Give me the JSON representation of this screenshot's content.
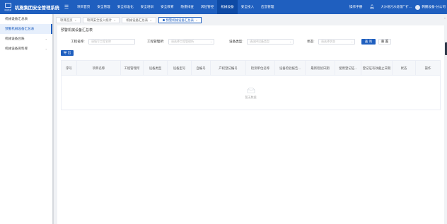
{
  "app": {
    "logo_text": "中国铁建",
    "title": "机施集团安全管理系统"
  },
  "nav": [
    "项目首页",
    "安全管理",
    "安全标准化",
    "安全培训",
    "安全教育",
    "隐患排查",
    "风险管控",
    "机械设备",
    "安全投入",
    "应急管理"
  ],
  "nav_active": 7,
  "header": {
    "manual": "操作手册",
    "org": "大沙地污水处理厂扩…",
    "user": "韩鹏设备-分公司"
  },
  "sidebar": [
    {
      "label": "机械设备汇总表",
      "active": false,
      "arrow": false
    },
    {
      "label": "预警机械设备汇总表",
      "active": true,
      "arrow": false
    },
    {
      "label": "机械设备台账",
      "active": false,
      "arrow": true
    },
    {
      "label": "机械设备资料库",
      "active": false,
      "arrow": true
    }
  ],
  "tabs": [
    {
      "label": "项目首页",
      "active": false
    },
    {
      "label": "项目安全投入统计",
      "active": false
    },
    {
      "label": "机械设备汇总表",
      "active": false
    },
    {
      "label": "预警机械设备汇总表",
      "active": true
    }
  ],
  "page": {
    "title": "预警机械设备汇总表",
    "filters": {
      "project_label": "工程名称:",
      "project_placeholder": "请填写工程名称",
      "mode_label": "工程管理所:",
      "mode_placeholder": "请选择工程管理所",
      "type_label": "设备类型:",
      "type_placeholder": "请选择设备类型",
      "status_label": "状态:",
      "status_placeholder": "请选择状态"
    },
    "search_button": "查 询",
    "reset_button": "重 置",
    "export_button": "导 出"
  },
  "table": {
    "columns": [
      "序号",
      "项目名称",
      "工程管理所",
      "设备类型",
      "设备型号",
      "自编号",
      "产权登记编号",
      "检测单位名称",
      "设备检验报告...",
      "最新检验日期",
      "使用登记证...",
      "登记证有效截止日期",
      "状态",
      "操作"
    ],
    "empty_text": "暂无数据"
  }
}
